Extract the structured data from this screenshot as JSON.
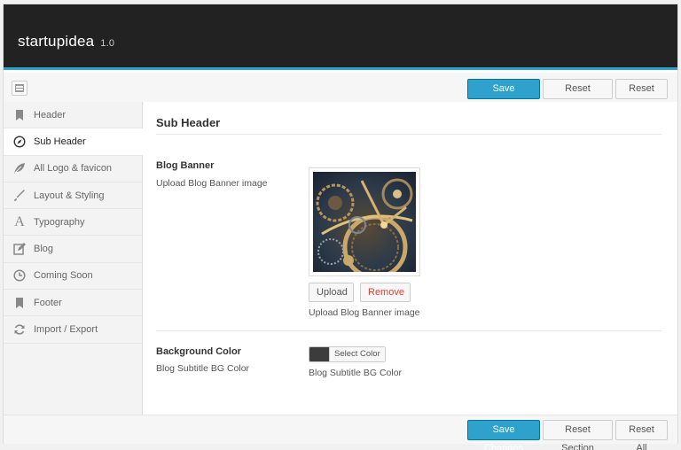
{
  "app": {
    "title": "startupidea",
    "version": "1.0"
  },
  "toolbar": {
    "save_label": "Save Changes",
    "reset_section_label": "Reset Section",
    "reset_all_label": "Reset All"
  },
  "footer": {
    "save_label": "Save Changes",
    "reset_section_label": "Reset Section",
    "reset_all_label": "Reset All"
  },
  "sidebar": {
    "active": "Sub Header",
    "items": [
      {
        "label": "Header",
        "icon": "bookmark-icon"
      },
      {
        "label": "Sub Header",
        "icon": "compass-icon"
      },
      {
        "label": "All Logo & favicon",
        "icon": "leaf-icon"
      },
      {
        "label": "Layout & Styling",
        "icon": "brush-icon"
      },
      {
        "label": "Typography",
        "icon": "font-icon"
      },
      {
        "label": "Blog",
        "icon": "edit-icon"
      },
      {
        "label": "Coming Soon",
        "icon": "clock-icon"
      },
      {
        "label": "Footer",
        "icon": "bookmark-icon"
      },
      {
        "label": "Import / Export",
        "icon": "refresh-icon"
      }
    ]
  },
  "main": {
    "section_title": "Sub Header",
    "fields": [
      {
        "title": "Blog Banner",
        "subtitle": "Upload Blog Banner image",
        "upload_label": "Upload",
        "remove_label": "Remove",
        "description": "Upload Blog Banner image"
      },
      {
        "title": "Background Color",
        "subtitle": "Blog Subtitle BG Color",
        "select_label": "Select Color",
        "value": "#3c3c3c",
        "description": "Blog Subtitle BG Color"
      }
    ]
  },
  "colors": {
    "header_bg": "#222222",
    "accent": "#2ea2cc",
    "remove_text": "#dd3d36"
  }
}
